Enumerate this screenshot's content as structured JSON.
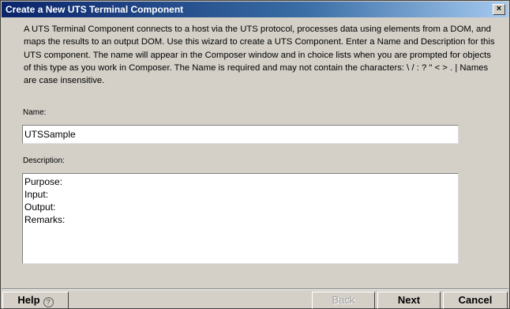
{
  "window": {
    "title": "Create a New UTS Terminal Component",
    "close_glyph": "×"
  },
  "intro": {
    "text": "A UTS Terminal Component connects to a host via the UTS protocol, processes data using elements from a DOM, and maps the results to an output DOM.  Use this wizard to create a UTS Component.  Enter a Name and Description for this UTS component.  The name will appear in the Composer window and in choice lists when you are prompted for objects of this type as you work in Composer.  The Name is required and may not contain the characters: \\ / : ? \" < > . |  Names are case insensitive."
  },
  "form": {
    "name_label": "Name:",
    "name_value": "UTSSample",
    "description_label": "Description:",
    "description_lines": [
      "Purpose:",
      "Input:",
      "Output:",
      "Remarks:"
    ]
  },
  "buttons": {
    "help_label": "Help",
    "help_icon": "?",
    "back_label": "Back",
    "next_label": "Next",
    "cancel_label": "Cancel"
  }
}
